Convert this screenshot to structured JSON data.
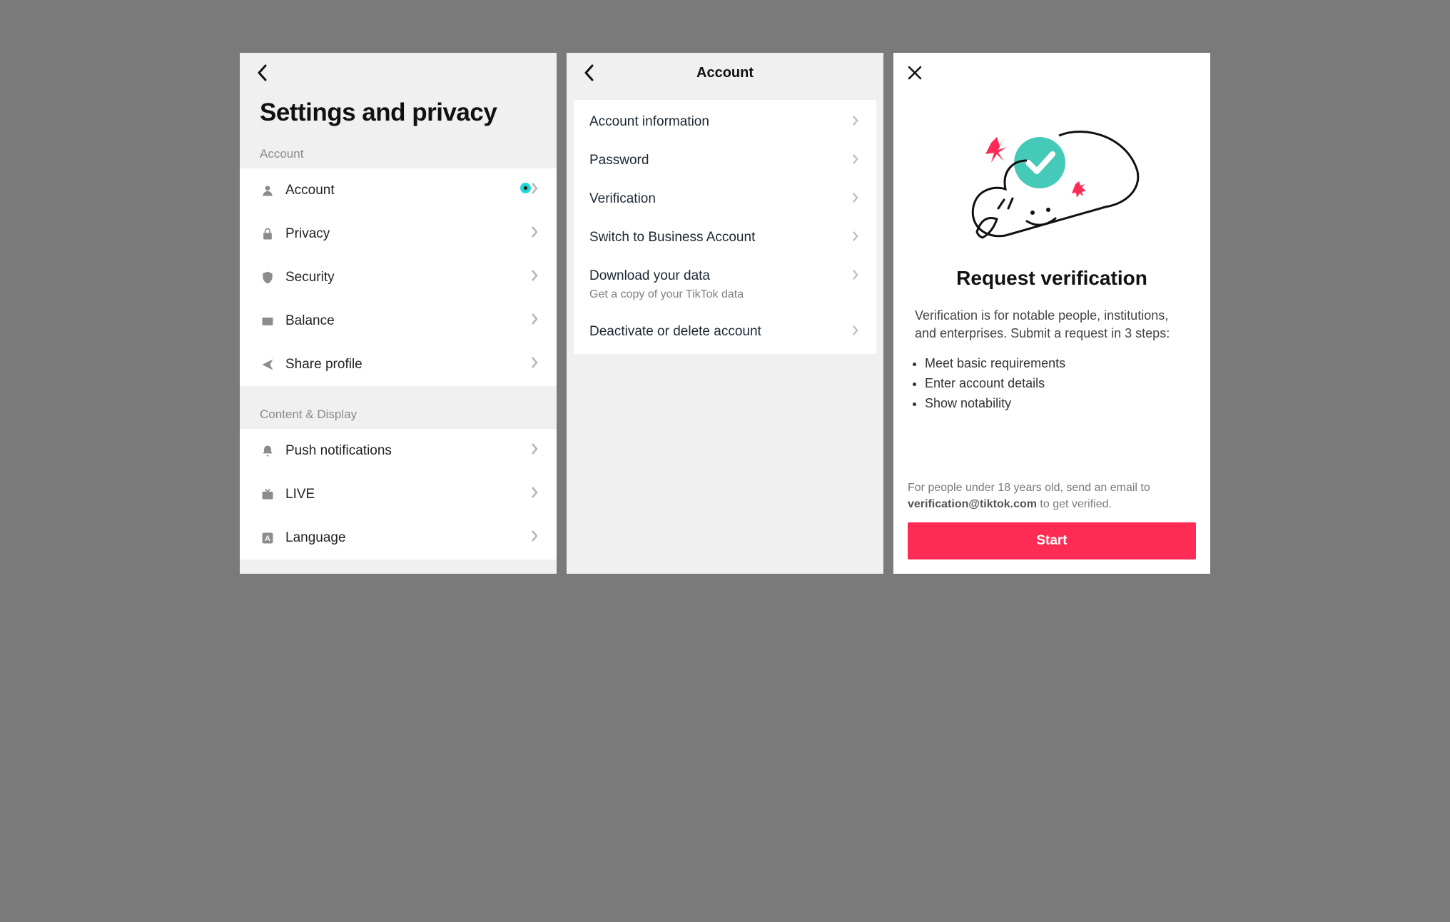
{
  "panel1": {
    "title": "Settings and privacy",
    "sections": [
      {
        "header": "Account",
        "items": [
          {
            "label": "Account",
            "icon": "person-icon",
            "has_dot": true
          },
          {
            "label": "Privacy",
            "icon": "lock-icon"
          },
          {
            "label": "Security",
            "icon": "shield-icon"
          },
          {
            "label": "Balance",
            "icon": "wallet-icon"
          },
          {
            "label": "Share profile",
            "icon": "share-icon"
          }
        ]
      },
      {
        "header": "Content & Display",
        "items": [
          {
            "label": "Push notifications",
            "icon": "bell-icon"
          },
          {
            "label": "LIVE",
            "icon": "tv-icon"
          },
          {
            "label": "Language",
            "icon": "a-box-icon"
          }
        ]
      }
    ]
  },
  "panel2": {
    "title": "Account",
    "items": [
      {
        "label": "Account information"
      },
      {
        "label": "Password"
      },
      {
        "label": "Verification"
      },
      {
        "label": "Switch to Business Account"
      },
      {
        "label": "Download your data",
        "sub": "Get a copy of your TikTok data"
      },
      {
        "label": "Deactivate or delete account"
      }
    ]
  },
  "panel3": {
    "title": "Request verification",
    "desc": "Verification is for notable people, institutions, and enterprises. Submit a request in 3 steps:",
    "steps": [
      "Meet basic requirements",
      "Enter account details",
      "Show notability"
    ],
    "email_prefix": "For people under 18 years old, send an email to ",
    "email": "verification@tiktok.com",
    "email_suffix": " to get verified.",
    "button": "Start",
    "accent_color": "#fe2c55",
    "check_color": "#38c8b5"
  }
}
